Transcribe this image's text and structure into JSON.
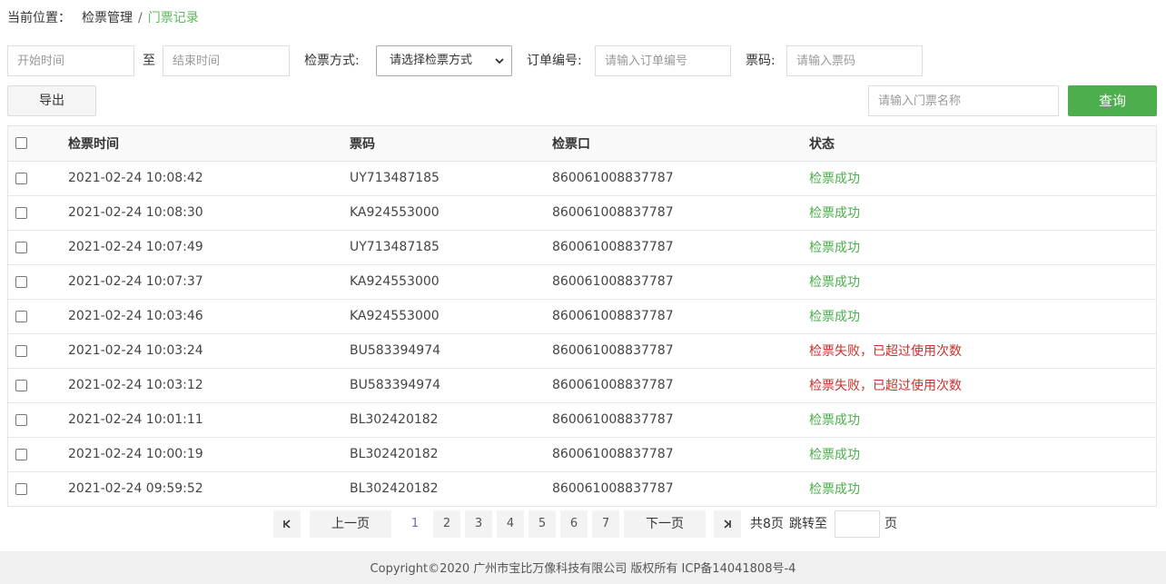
{
  "breadcrumb": {
    "label": "当前位置：",
    "items": [
      "检票管理"
    ],
    "separator": "/",
    "current": "门票记录"
  },
  "filters": {
    "start_time_placeholder": "开始时间",
    "to_label": "至",
    "end_time_placeholder": "结束时间",
    "method_label": "检票方式:",
    "method_selected": "请选择检票方式",
    "order_label": "订单编号:",
    "order_placeholder": "请输入订单编号",
    "code_label": "票码:",
    "code_placeholder": "请输入票码",
    "ticket_name_placeholder": "请输入门票名称"
  },
  "buttons": {
    "export": "导出",
    "query": "查询"
  },
  "table": {
    "headers": [
      "检票时间",
      "票码",
      "检票口",
      "状态"
    ],
    "rows": [
      {
        "time": "2021-02-24 10:08:42",
        "code": "UY713487185",
        "gate": "860061008837787",
        "status": "检票成功",
        "ok": true
      },
      {
        "time": "2021-02-24 10:08:30",
        "code": "KA924553000",
        "gate": "860061008837787",
        "status": "检票成功",
        "ok": true
      },
      {
        "time": "2021-02-24 10:07:49",
        "code": "UY713487185",
        "gate": "860061008837787",
        "status": "检票成功",
        "ok": true
      },
      {
        "time": "2021-02-24 10:07:37",
        "code": "KA924553000",
        "gate": "860061008837787",
        "status": "检票成功",
        "ok": true
      },
      {
        "time": "2021-02-24 10:03:46",
        "code": "KA924553000",
        "gate": "860061008837787",
        "status": "检票成功",
        "ok": true
      },
      {
        "time": "2021-02-24 10:03:24",
        "code": "BU583394974",
        "gate": "860061008837787",
        "status": "检票失败，已超过使用次数",
        "ok": false
      },
      {
        "time": "2021-02-24 10:03:12",
        "code": "BU583394974",
        "gate": "860061008837787",
        "status": "检票失败，已超过使用次数",
        "ok": false
      },
      {
        "time": "2021-02-24 10:01:11",
        "code": "BL302420182",
        "gate": "860061008837787",
        "status": "检票成功",
        "ok": true
      },
      {
        "time": "2021-02-24 10:00:19",
        "code": "BL302420182",
        "gate": "860061008837787",
        "status": "检票成功",
        "ok": true
      },
      {
        "time": "2021-02-24 09:59:52",
        "code": "BL302420182",
        "gate": "860061008837787",
        "status": "检票成功",
        "ok": true
      }
    ]
  },
  "pagination": {
    "first": "K",
    "prev": "上一页",
    "pages": [
      "1",
      "2",
      "3",
      "4",
      "5",
      "6",
      "7"
    ],
    "current_page": "1",
    "next": "下一页",
    "last": "K",
    "total": "共8页",
    "jump_label": "跳转至",
    "page_suffix": "页"
  },
  "footer": {
    "text": "Copyright©2020 广州市宝比万像科技有限公司 版权所有 ICP备14041808号-4"
  },
  "colors": {
    "success": "#4cae4c",
    "fail": "#c9302c",
    "accent": "#5cb85c"
  }
}
